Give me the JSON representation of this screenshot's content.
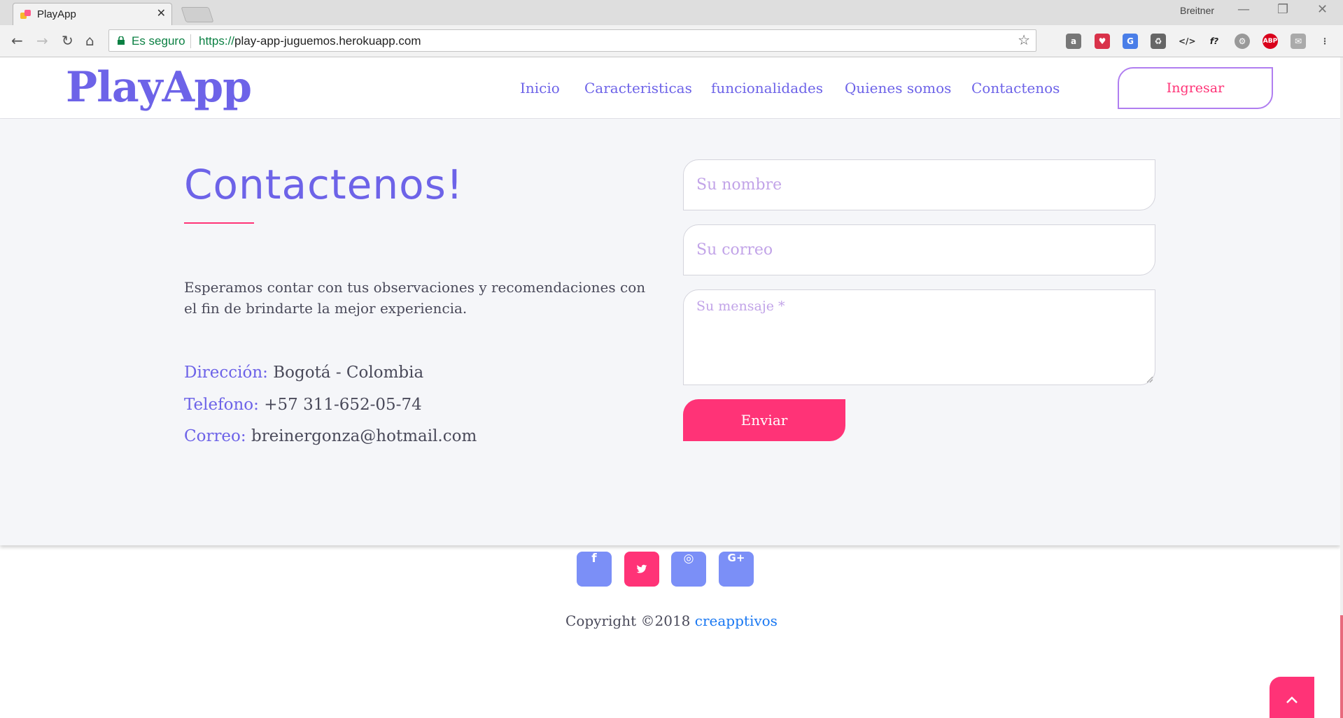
{
  "browser": {
    "tab_title": "PlayApp",
    "tab_close": "✕",
    "profile_name": "Breitner",
    "minimize": "—",
    "restore": "❐",
    "close": "✕",
    "secure_label": "Es seguro",
    "url_protocol": "https://",
    "url_host": "play-app-juguemos.herokuapp.com",
    "extension_icons": [
      "bag-icon",
      "save-icon",
      "translate-icon",
      "recycle-icon",
      "code-icon",
      "font-icon",
      "gear-icon",
      "adblock-plus-icon",
      "inbox-icon",
      "menu-icon"
    ],
    "extension_labels": {
      "font": "f?",
      "adblock": "ABP"
    }
  },
  "header": {
    "logo": "PlayApp",
    "nav": [
      "Inicio",
      "Caracteristicas",
      "funcionalidades",
      "Quienes somos",
      "Contactenos"
    ],
    "login_button": "Ingresar"
  },
  "contact": {
    "title": "Contactenos!",
    "description": "Esperamos contar con tus observaciones y recomendaciones con el fin de brindarte la mejor experiencia.",
    "address_label": "Dirección:",
    "address_value": "Bogotá - Colombia",
    "phone_label": "Telefono:",
    "phone_value": "+57 311-652-05-74",
    "email_label": "Correo:",
    "email_value": "breinergonza@hotmail.com",
    "form": {
      "name_placeholder": "Su nombre",
      "email_placeholder": "Su correo",
      "message_placeholder": "Su mensaje *",
      "submit_label": "Enviar"
    }
  },
  "footer": {
    "social": [
      {
        "icon": "facebook-icon",
        "glyph": "f",
        "color": "#7b8ff7"
      },
      {
        "icon": "twitter-icon",
        "glyph": "🐦",
        "color": "#ff3377"
      },
      {
        "icon": "instagram-icon",
        "glyph": "◎",
        "color": "#7b8ff7"
      },
      {
        "icon": "google-plus-icon",
        "glyph": "G+",
        "color": "#7b8ff7"
      }
    ],
    "copyright_prefix": "Copyright ©2018",
    "copyright_brand": "creapptivos"
  },
  "colors": {
    "accent_purple": "#6d63e8",
    "accent_pink": "#ff3377",
    "link_blue": "#1877f2"
  }
}
